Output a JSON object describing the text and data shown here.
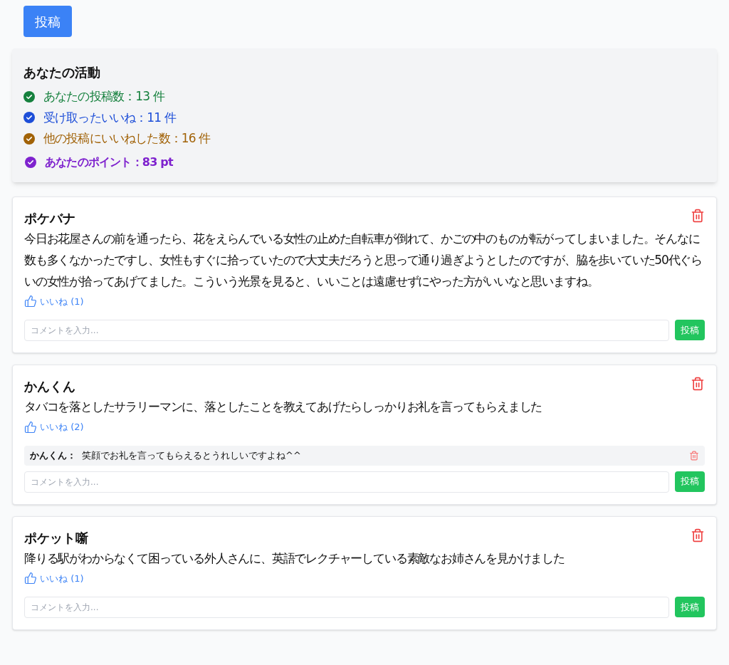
{
  "post_button": "投稿",
  "activity": {
    "title": "あなたの活動",
    "stats": [
      {
        "kind": "count",
        "color": "#15803d",
        "text": "あなたの投稿数：13 件"
      },
      {
        "kind": "count",
        "color": "#1d4ed8",
        "text": "受け取ったいいね：11 件"
      },
      {
        "kind": "count",
        "color": "#a16207",
        "text": "他の投稿にいいねした数：16 件"
      },
      {
        "kind": "points",
        "color": "#7e22ce",
        "text": "あなたのポイント：83 pt"
      }
    ]
  },
  "posts": [
    {
      "author": "ポケバナ",
      "body": "今日お花屋さんの前を通ったら、花をえらんでいる女性の止めた自転車が倒れて、かごの中のものが転がってしまいました。そんなに数も多くなかったですし、女性もすぐに拾っていたので大丈夫だろうと思って通り過ぎようとしたのですが、脇を歩いていた50代ぐらいの女性が拾ってあげてました。こういう光景を見ると、いいことは遠慮せずにやった方がいいなと思いますね。",
      "like": "いいね (1)",
      "comment_placeholder": "コメントを入力...",
      "comment_button": "投稿"
    },
    {
      "author": "かんくん",
      "body": "タバコを落としたサラリーマンに、落としたことを教えてあげたらしっかりお礼を言ってもらえました",
      "like": "いいね (2)",
      "comments": [
        {
          "author": "かんくん：",
          "text": "笑顔でお礼を言ってもらえるとうれしいですよね^^"
        }
      ],
      "comment_placeholder": "コメントを入力...",
      "comment_button": "投稿"
    },
    {
      "author": "ポケット噺",
      "body": "降りる駅がわからなくて困っている外人さんに、英語でレクチャーしている素敵なお姉さんを見かけました",
      "like": "いいね (1)",
      "comment_placeholder": "コメントを入力...",
      "comment_button": "投稿"
    }
  ]
}
